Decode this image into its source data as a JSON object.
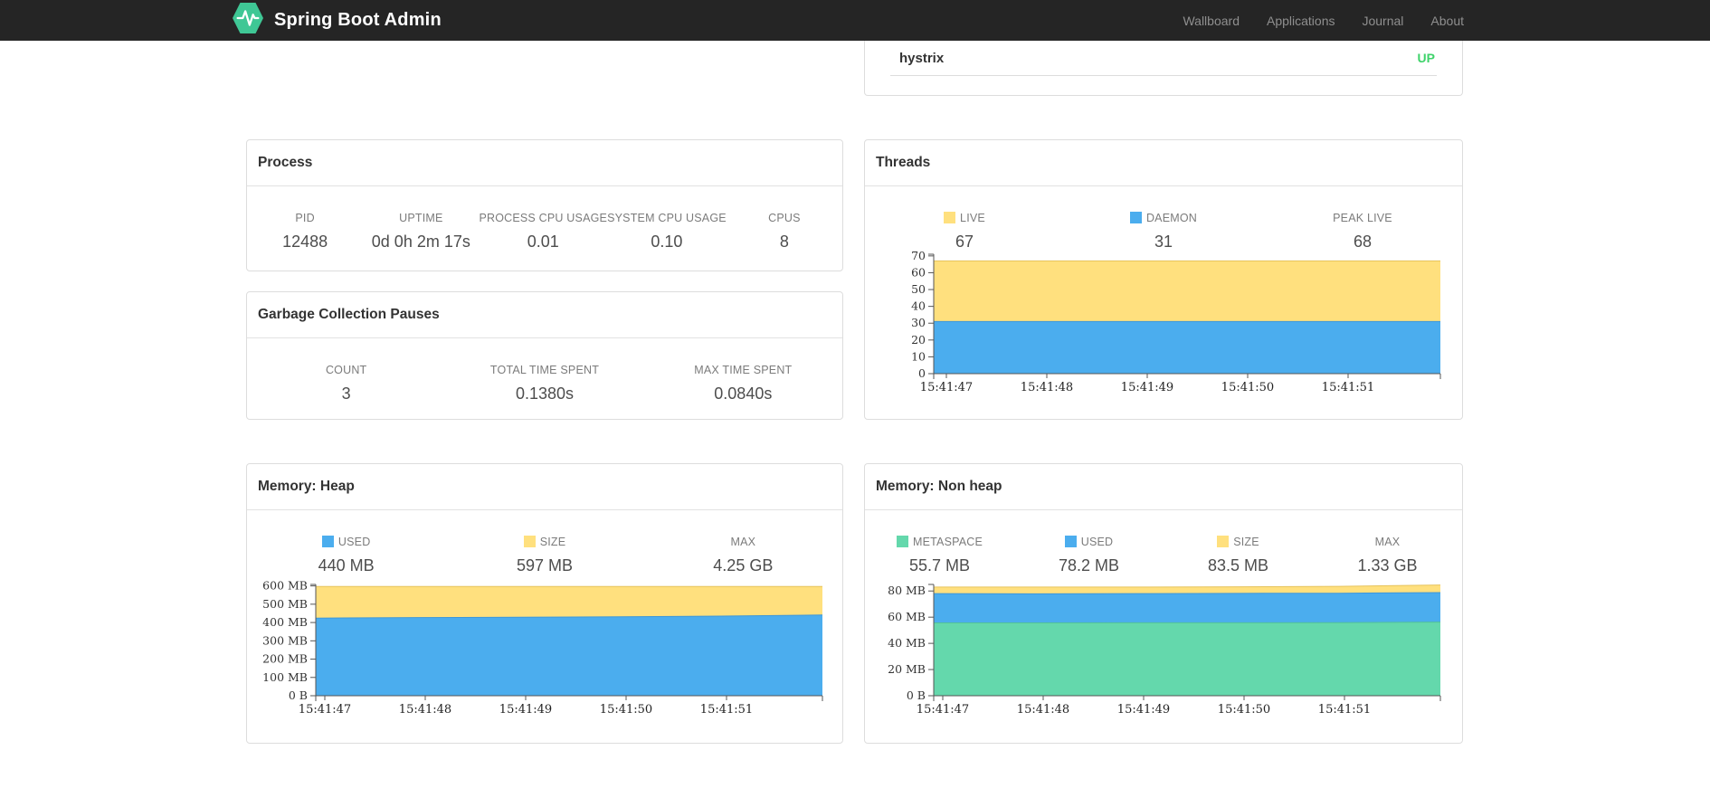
{
  "navbar": {
    "brand": "Spring Boot Admin",
    "links": [
      "Wallboard",
      "Applications",
      "Journal",
      "About"
    ],
    "background": "#252525",
    "logo_color": "#3fc795"
  },
  "application_status": {
    "name": "hystrix",
    "status": "UP",
    "status_color": "#3fd36b"
  },
  "process": {
    "title": "Process",
    "metrics": [
      {
        "label": "PID",
        "value": "12488"
      },
      {
        "label": "UPTIME",
        "value": "0d 0h 2m 17s"
      },
      {
        "label": "PROCESS CPU USAGE",
        "value": "0.01"
      },
      {
        "label": "SYSTEM CPU USAGE",
        "value": "0.10"
      },
      {
        "label": "CPUS",
        "value": "8"
      }
    ]
  },
  "gc": {
    "title": "Garbage Collection Pauses",
    "metrics": [
      {
        "label": "COUNT",
        "value": "3"
      },
      {
        "label": "TOTAL TIME SPENT",
        "value": "0.1380s"
      },
      {
        "label": "MAX TIME SPENT",
        "value": "0.0840s"
      }
    ]
  },
  "threads": {
    "title": "Threads",
    "metrics": [
      {
        "label": "LIVE",
        "value": "67",
        "color": "#ffe07e"
      },
      {
        "label": "DAEMON",
        "value": "31",
        "color": "#4badee"
      },
      {
        "label": "PEAK LIVE",
        "value": "68",
        "color": null
      }
    ]
  },
  "memory_heap": {
    "title": "Memory: Heap",
    "metrics": [
      {
        "label": "USED",
        "value": "440 MB",
        "color": "#4badee"
      },
      {
        "label": "SIZE",
        "value": "597 MB",
        "color": "#ffe07e"
      },
      {
        "label": "MAX",
        "value": "4.25 GB",
        "color": null
      }
    ]
  },
  "memory_nonheap": {
    "title": "Memory: Non heap",
    "metrics": [
      {
        "label": "METASPACE",
        "value": "55.7 MB",
        "color": "#64d8ac"
      },
      {
        "label": "USED",
        "value": "78.2 MB",
        "color": "#4badee"
      },
      {
        "label": "SIZE",
        "value": "83.5 MB",
        "color": "#ffe07e"
      },
      {
        "label": "MAX",
        "value": "1.33 GB",
        "color": null
      }
    ]
  },
  "chart_data": [
    {
      "type": "area",
      "stacked": true,
      "title": "Threads",
      "x_tick_labels": [
        "15:41:47",
        "15:41:48",
        "15:41:49",
        "15:41:50",
        "15:41:51"
      ],
      "n_points": 6,
      "ylim": [
        0,
        71
      ],
      "grid": false,
      "legend_position": "top",
      "yticks": [
        {
          "v": 0,
          "label": "0"
        },
        {
          "v": 10,
          "label": "10"
        },
        {
          "v": 20,
          "label": "20"
        },
        {
          "v": 30,
          "label": "30"
        },
        {
          "v": 40,
          "label": "40"
        },
        {
          "v": 50,
          "label": "50"
        },
        {
          "v": 60,
          "label": "60"
        },
        {
          "v": 70,
          "label": "70"
        }
      ],
      "series": [
        {
          "name": "LIVE",
          "color": "#ffe07e",
          "stroke": "#e6c35c",
          "values": [
            67,
            67,
            67,
            67,
            67,
            67
          ]
        },
        {
          "name": "DAEMON",
          "color": "#4badee",
          "stroke": "#3e97d8",
          "values": [
            31,
            31,
            31,
            31,
            31,
            31
          ]
        }
      ]
    },
    {
      "type": "area",
      "stacked": true,
      "title": "Memory: Heap",
      "x_tick_labels": [
        "15:41:47",
        "15:41:48",
        "15:41:49",
        "15:41:50",
        "15:41:51"
      ],
      "n_points": 6,
      "ylim": [
        0,
        608
      ],
      "grid": false,
      "legend_position": "top",
      "yticks": [
        {
          "v": 0,
          "label": "0 B"
        },
        {
          "v": 100,
          "label": "100 MB"
        },
        {
          "v": 200,
          "label": "200 MB"
        },
        {
          "v": 300,
          "label": "300 MB"
        },
        {
          "v": 400,
          "label": "400 MB"
        },
        {
          "v": 500,
          "label": "500 MB"
        },
        {
          "v": 600,
          "label": "600 MB"
        }
      ],
      "series": [
        {
          "name": "SIZE",
          "color": "#ffe07e",
          "stroke": "#e6c35c",
          "values": [
            597,
            597,
            597,
            597,
            597,
            597
          ]
        },
        {
          "name": "USED",
          "color": "#4badee",
          "stroke": "#3e97d8",
          "values": [
            424,
            427,
            429,
            431,
            435,
            441
          ]
        }
      ]
    },
    {
      "type": "area",
      "stacked": true,
      "title": "Memory: Non heap",
      "x_tick_labels": [
        "15:41:47",
        "15:41:48",
        "15:41:49",
        "15:41:50",
        "15:41:51"
      ],
      "n_points": 6,
      "ylim": [
        0,
        85
      ],
      "grid": false,
      "legend_position": "top",
      "yticks": [
        {
          "v": 0,
          "label": "0 B"
        },
        {
          "v": 20,
          "label": "20 MB"
        },
        {
          "v": 40,
          "label": "40 MB"
        },
        {
          "v": 60,
          "label": "60 MB"
        },
        {
          "v": 80,
          "label": "80 MB"
        }
      ],
      "series": [
        {
          "name": "SIZE",
          "color": "#ffe07e",
          "stroke": "#e6c35c",
          "values": [
            83,
            83,
            83,
            83.2,
            83.5,
            84.6
          ]
        },
        {
          "name": "USED",
          "color": "#4badee",
          "stroke": "#3e97d8",
          "values": [
            78,
            77.8,
            78,
            78.2,
            78.3,
            78.8
          ]
        },
        {
          "name": "METASPACE",
          "color": "#64d8ac",
          "stroke": "#52c299",
          "values": [
            55.6,
            55.6,
            55.7,
            55.7,
            55.8,
            56.2
          ]
        }
      ]
    }
  ]
}
